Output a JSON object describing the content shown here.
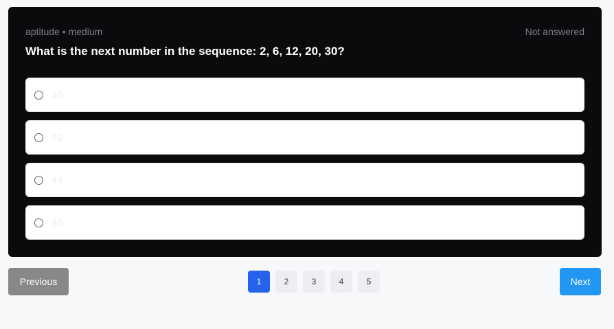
{
  "question": {
    "meta": "aptitude • medium",
    "status": "Not answered",
    "text": "What is the next number in the sequence: 2, 6, 12, 20, 30?",
    "options": [
      {
        "label": "40"
      },
      {
        "label": "42"
      },
      {
        "label": "44"
      },
      {
        "label": "46"
      }
    ]
  },
  "navigation": {
    "previous_label": "Previous",
    "next_label": "Next",
    "pages": [
      "1",
      "2",
      "3",
      "4",
      "5"
    ],
    "current_page": "1"
  },
  "colors": {
    "card_background": "#0b0b0d",
    "active_page": "#2563eb",
    "next_button": "#2196f3",
    "previous_button": "#878889"
  }
}
